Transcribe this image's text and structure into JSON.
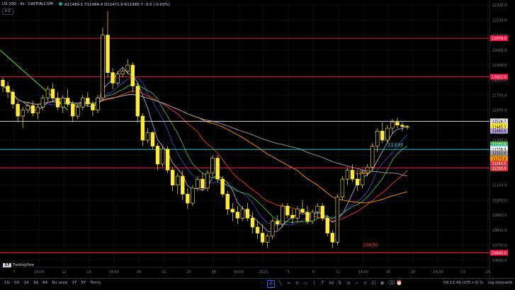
{
  "header": {
    "symbol": "US 100 · 4s · CAPITALCOM",
    "ohlc": "A11489.1  Y11494.4  D11471.9  K11485.7  -3.5 (-0.03%)",
    "collapse_label": "▾ 2"
  },
  "colors": {
    "bg": "#000000",
    "grid": "#131722",
    "candle_up": "#ffeb3b",
    "candle_down": "#ffeb3b",
    "red_level": "#ff1744",
    "cyan_level": "#4dd0e1",
    "white_level": "#e0e0e0",
    "ma_violet": "#b39ddb",
    "ma_blue": "#3949ab",
    "ma_green": "#4caf50",
    "ma_red": "#e53935",
    "ma_orange": "#ff9800",
    "ma_silver": "#9e9e9e",
    "ma_lime": "#76ff03"
  },
  "chart_data": {
    "type": "candlestick",
    "ylim": [
      10580,
      12315
    ],
    "y_ticks": [
      12300,
      12200,
      12100,
      12000,
      11900,
      11800,
      11700,
      11600,
      11500,
      11400,
      11300,
      11200,
      11100,
      11000,
      10900,
      10800,
      10700,
      10600
    ],
    "x_labels": [
      "7",
      "14:00",
      "12",
      "14",
      "14:00",
      "19",
      "21",
      "23",
      "28",
      "14:00",
      "2023",
      "5",
      "9",
      "11",
      "14:00",
      "16",
      "18",
      "14:00",
      "23",
      "25"
    ],
    "candles": [
      [
        11800,
        11820,
        11720,
        11760
      ],
      [
        11760,
        11790,
        11680,
        11720
      ],
      [
        11720,
        11740,
        11610,
        11640
      ],
      [
        11640,
        11660,
        11520,
        11560
      ],
      [
        11560,
        11620,
        11480,
        11600
      ],
      [
        11600,
        11650,
        11580,
        11630
      ],
      [
        11630,
        11660,
        11560,
        11580
      ],
      [
        11580,
        11640,
        11540,
        11620
      ],
      [
        11620,
        11700,
        11600,
        11680
      ],
      [
        11680,
        11760,
        11660,
        11740
      ],
      [
        11740,
        11780,
        11660,
        11680
      ],
      [
        11680,
        11720,
        11600,
        11620
      ],
      [
        11620,
        11700,
        11580,
        11680
      ],
      [
        11680,
        11740,
        11620,
        11640
      ],
      [
        11640,
        11660,
        11520,
        11560
      ],
      [
        11560,
        11640,
        11540,
        11620
      ],
      [
        11620,
        11700,
        11600,
        11680
      ],
      [
        11680,
        11720,
        11620,
        11640
      ],
      [
        11640,
        11660,
        11560,
        11600
      ],
      [
        11600,
        11700,
        11580,
        11680
      ],
      [
        11680,
        12150,
        11660,
        12100
      ],
      [
        12100,
        12260,
        11820,
        11850
      ],
      [
        11850,
        11880,
        11740,
        11780
      ],
      [
        11780,
        11860,
        11760,
        11840
      ],
      [
        11840,
        11880,
        11820,
        11860
      ],
      [
        11860,
        11940,
        11840,
        11900
      ],
      [
        11900,
        11920,
        11720,
        11760
      ],
      [
        11760,
        11780,
        11520,
        11560
      ],
      [
        11560,
        11580,
        11360,
        11400
      ],
      [
        11400,
        11480,
        11380,
        11450
      ],
      [
        11450,
        11460,
        11340,
        11360
      ],
      [
        11360,
        11380,
        11200,
        11240
      ],
      [
        11240,
        11360,
        11220,
        11340
      ],
      [
        11340,
        11360,
        11180,
        11200
      ],
      [
        11200,
        11220,
        11060,
        11100
      ],
      [
        11100,
        11180,
        11040,
        11160
      ],
      [
        11160,
        11200,
        11000,
        11040
      ],
      [
        11040,
        11080,
        10940,
        10980
      ],
      [
        10980,
        11100,
        10960,
        11080
      ],
      [
        11080,
        11160,
        11060,
        11140
      ],
      [
        11140,
        11180,
        11060,
        11080
      ],
      [
        11080,
        11200,
        11060,
        11180
      ],
      [
        11180,
        11300,
        11160,
        11280
      ],
      [
        11280,
        11300,
        11120,
        11140
      ],
      [
        11140,
        11160,
        11020,
        11040
      ],
      [
        11040,
        11060,
        10900,
        10940
      ],
      [
        10940,
        10980,
        10860,
        10920
      ],
      [
        10920,
        10960,
        10840,
        10880
      ],
      [
        10880,
        10960,
        10860,
        10940
      ],
      [
        10940,
        10980,
        10860,
        10880
      ],
      [
        10880,
        10920,
        10780,
        10820
      ],
      [
        10820,
        10860,
        10740,
        10780
      ],
      [
        10780,
        10840,
        10700,
        10720
      ],
      [
        10720,
        10780,
        10680,
        10760
      ],
      [
        10760,
        10880,
        10740,
        10860
      ],
      [
        10860,
        10900,
        10800,
        10840
      ],
      [
        10840,
        10980,
        10820,
        10960
      ],
      [
        10960,
        10980,
        10880,
        10900
      ],
      [
        10900,
        10940,
        10840,
        10880
      ],
      [
        10880,
        10960,
        10860,
        10940
      ],
      [
        10940,
        11000,
        10900,
        10920
      ],
      [
        10920,
        10960,
        10840,
        10860
      ],
      [
        10860,
        10940,
        10840,
        10920
      ],
      [
        10920,
        10980,
        10880,
        10960
      ],
      [
        10960,
        10980,
        10860,
        10880
      ],
      [
        10880,
        10900,
        10760,
        10780
      ],
      [
        10780,
        10800,
        10680,
        10720
      ],
      [
        10720,
        11040,
        10700,
        11020
      ],
      [
        11020,
        11160,
        11000,
        11140
      ],
      [
        11140,
        11220,
        11100,
        11200
      ],
      [
        11200,
        11240,
        11120,
        11140
      ],
      [
        11140,
        11180,
        11060,
        11100
      ],
      [
        11100,
        11200,
        11080,
        11180
      ],
      [
        11180,
        11240,
        11160,
        11220
      ],
      [
        11220,
        11380,
        11200,
        11360
      ],
      [
        11360,
        11480,
        11320,
        11460
      ],
      [
        11460,
        11520,
        11380,
        11400
      ],
      [
        11400,
        11500,
        11380,
        11480
      ],
      [
        11480,
        11540,
        11440,
        11520
      ],
      [
        11520,
        11550,
        11480,
        11500
      ],
      [
        11500,
        11520,
        11460,
        11490
      ],
      [
        11490,
        11500,
        11470,
        11486
      ]
    ],
    "h_levels": [
      {
        "value": 12079,
        "label": "12079.0",
        "color": "red"
      },
      {
        "value": 11822,
        "label": "11822.0",
        "color": "red"
      },
      {
        "value": 11525,
        "label": "11525.0",
        "color": "white"
      },
      {
        "value": 11338,
        "label": "11338.9",
        "color": "cyan"
      },
      {
        "value": 11214,
        "label": "11214.3",
        "color": "red"
      },
      {
        "value": 10649,
        "label": "10649.0",
        "color": "red"
      }
    ],
    "price_tags": [
      {
        "value": 11524.7,
        "label": "11524.7",
        "bg": "#e0e0e0",
        "fg": "#000"
      },
      {
        "value": 11495,
        "label": "11495.3",
        "bg": "#ffeb3b",
        "fg": "#000"
      },
      {
        "value": 11485.7,
        "label": "11485.7",
        "bg": "#ffeb3b",
        "fg": "#000"
      },
      {
        "value": 11460,
        "label": "11460.6",
        "bg": "#b39ddb",
        "fg": "#000"
      },
      {
        "value": 11372,
        "label": "11372.6",
        "bg": "#4caf50",
        "fg": "#fff"
      },
      {
        "value": 11347,
        "label": "11347.1",
        "bg": "#4dd0e1",
        "fg": "#000"
      },
      {
        "value": 11338.9,
        "label": "11338.9",
        "bg": "#ffffff",
        "fg": "#000"
      },
      {
        "value": 11313,
        "label": "11313.0",
        "bg": "#9e9e9e",
        "fg": "#000"
      },
      {
        "value": 11275.6,
        "label": "11275.6",
        "bg": "#ff9800",
        "fg": "#000"
      },
      {
        "value": 11243,
        "label": "11243.1",
        "bg": "#e53935",
        "fg": "#fff"
      },
      {
        "value": 11214.3,
        "label": "11214.3",
        "bg": "#3949ab",
        "fg": "#fff"
      },
      {
        "value": 11210.4,
        "label": "11210.4",
        "bg": "#e53935",
        "fg": "#fff"
      }
    ],
    "annotations": [
      {
        "text": "11335",
        "x_index": 77,
        "value": 11355,
        "color": "#4dd0e1"
      },
      {
        "text": "11200",
        "x_index": 70,
        "value": 11175,
        "color": "#ff9800"
      },
      {
        "text": "10650",
        "x_index": 72,
        "value": 10690,
        "color": "#e53935"
      }
    ]
  },
  "bottom": {
    "timeframes": [
      "1G",
      "5G",
      "1A",
      "3A",
      "6A",
      "Bu sene",
      "1Y",
      "5Y",
      "Tümü"
    ],
    "clock": "09:13:49 (UTC+3)",
    "pct": "%",
    "log": "log",
    "auto": "otomatik"
  },
  "watermark": "TradingView"
}
